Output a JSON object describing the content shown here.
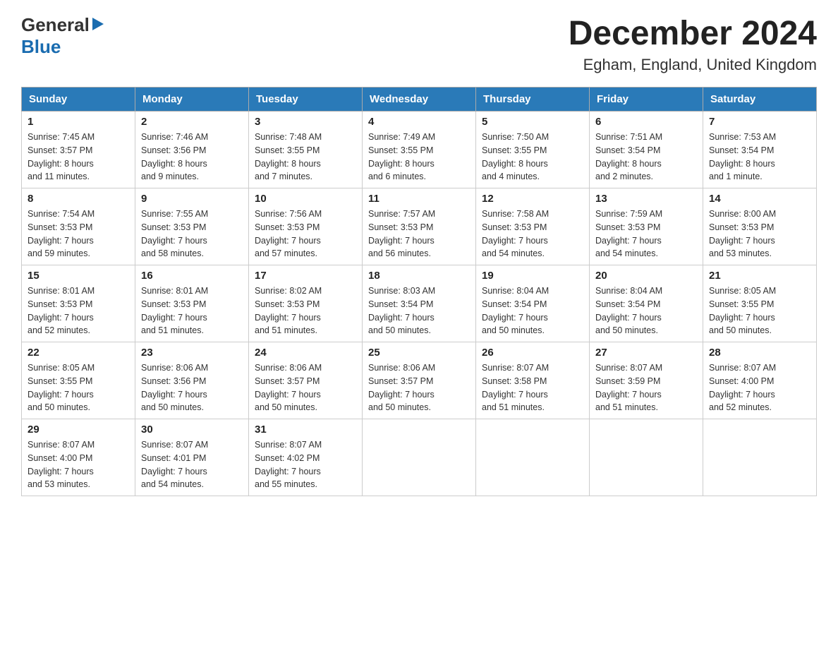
{
  "header": {
    "logo": {
      "line1": "General",
      "triangle_symbol": "▶",
      "line2": "Blue"
    },
    "title": "December 2024",
    "location": "Egham, England, United Kingdom"
  },
  "calendar": {
    "days_of_week": [
      "Sunday",
      "Monday",
      "Tuesday",
      "Wednesday",
      "Thursday",
      "Friday",
      "Saturday"
    ],
    "weeks": [
      [
        {
          "day": "1",
          "sunrise": "7:45 AM",
          "sunset": "3:57 PM",
          "daylight": "8 hours and 11 minutes."
        },
        {
          "day": "2",
          "sunrise": "7:46 AM",
          "sunset": "3:56 PM",
          "daylight": "8 hours and 9 minutes."
        },
        {
          "day": "3",
          "sunrise": "7:48 AM",
          "sunset": "3:55 PM",
          "daylight": "8 hours and 7 minutes."
        },
        {
          "day": "4",
          "sunrise": "7:49 AM",
          "sunset": "3:55 PM",
          "daylight": "8 hours and 6 minutes."
        },
        {
          "day": "5",
          "sunrise": "7:50 AM",
          "sunset": "3:55 PM",
          "daylight": "8 hours and 4 minutes."
        },
        {
          "day": "6",
          "sunrise": "7:51 AM",
          "sunset": "3:54 PM",
          "daylight": "8 hours and 2 minutes."
        },
        {
          "day": "7",
          "sunrise": "7:53 AM",
          "sunset": "3:54 PM",
          "daylight": "8 hours and 1 minute."
        }
      ],
      [
        {
          "day": "8",
          "sunrise": "7:54 AM",
          "sunset": "3:53 PM",
          "daylight": "7 hours and 59 minutes."
        },
        {
          "day": "9",
          "sunrise": "7:55 AM",
          "sunset": "3:53 PM",
          "daylight": "7 hours and 58 minutes."
        },
        {
          "day": "10",
          "sunrise": "7:56 AM",
          "sunset": "3:53 PM",
          "daylight": "7 hours and 57 minutes."
        },
        {
          "day": "11",
          "sunrise": "7:57 AM",
          "sunset": "3:53 PM",
          "daylight": "7 hours and 56 minutes."
        },
        {
          "day": "12",
          "sunrise": "7:58 AM",
          "sunset": "3:53 PM",
          "daylight": "7 hours and 54 minutes."
        },
        {
          "day": "13",
          "sunrise": "7:59 AM",
          "sunset": "3:53 PM",
          "daylight": "7 hours and 54 minutes."
        },
        {
          "day": "14",
          "sunrise": "8:00 AM",
          "sunset": "3:53 PM",
          "daylight": "7 hours and 53 minutes."
        }
      ],
      [
        {
          "day": "15",
          "sunrise": "8:01 AM",
          "sunset": "3:53 PM",
          "daylight": "7 hours and 52 minutes."
        },
        {
          "day": "16",
          "sunrise": "8:01 AM",
          "sunset": "3:53 PM",
          "daylight": "7 hours and 51 minutes."
        },
        {
          "day": "17",
          "sunrise": "8:02 AM",
          "sunset": "3:53 PM",
          "daylight": "7 hours and 51 minutes."
        },
        {
          "day": "18",
          "sunrise": "8:03 AM",
          "sunset": "3:54 PM",
          "daylight": "7 hours and 50 minutes."
        },
        {
          "day": "19",
          "sunrise": "8:04 AM",
          "sunset": "3:54 PM",
          "daylight": "7 hours and 50 minutes."
        },
        {
          "day": "20",
          "sunrise": "8:04 AM",
          "sunset": "3:54 PM",
          "daylight": "7 hours and 50 minutes."
        },
        {
          "day": "21",
          "sunrise": "8:05 AM",
          "sunset": "3:55 PM",
          "daylight": "7 hours and 50 minutes."
        }
      ],
      [
        {
          "day": "22",
          "sunrise": "8:05 AM",
          "sunset": "3:55 PM",
          "daylight": "7 hours and 50 minutes."
        },
        {
          "day": "23",
          "sunrise": "8:06 AM",
          "sunset": "3:56 PM",
          "daylight": "7 hours and 50 minutes."
        },
        {
          "day": "24",
          "sunrise": "8:06 AM",
          "sunset": "3:57 PM",
          "daylight": "7 hours and 50 minutes."
        },
        {
          "day": "25",
          "sunrise": "8:06 AM",
          "sunset": "3:57 PM",
          "daylight": "7 hours and 50 minutes."
        },
        {
          "day": "26",
          "sunrise": "8:07 AM",
          "sunset": "3:58 PM",
          "daylight": "7 hours and 51 minutes."
        },
        {
          "day": "27",
          "sunrise": "8:07 AM",
          "sunset": "3:59 PM",
          "daylight": "7 hours and 51 minutes."
        },
        {
          "day": "28",
          "sunrise": "8:07 AM",
          "sunset": "4:00 PM",
          "daylight": "7 hours and 52 minutes."
        }
      ],
      [
        {
          "day": "29",
          "sunrise": "8:07 AM",
          "sunset": "4:00 PM",
          "daylight": "7 hours and 53 minutes."
        },
        {
          "day": "30",
          "sunrise": "8:07 AM",
          "sunset": "4:01 PM",
          "daylight": "7 hours and 54 minutes."
        },
        {
          "day": "31",
          "sunrise": "8:07 AM",
          "sunset": "4:02 PM",
          "daylight": "7 hours and 55 minutes."
        },
        null,
        null,
        null,
        null
      ]
    ]
  }
}
